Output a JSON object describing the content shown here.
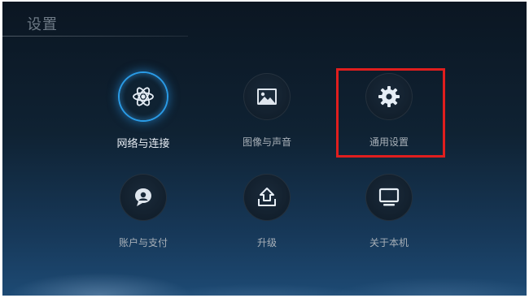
{
  "header": {
    "title": "设置"
  },
  "menu": {
    "items": [
      {
        "label": "网络与连接",
        "icon": "atom-icon",
        "selected": true
      },
      {
        "label": "图像与声音",
        "icon": "image-icon",
        "selected": false
      },
      {
        "label": "通用设置",
        "icon": "gear-icon",
        "selected": false
      },
      {
        "label": "账户与支付",
        "icon": "account-icon",
        "selected": false
      },
      {
        "label": "升级",
        "icon": "upgrade-icon",
        "selected": false
      },
      {
        "label": "关于本机",
        "icon": "monitor-icon",
        "selected": false
      }
    ]
  },
  "colors": {
    "selection_glow": "#2a9be6",
    "highlight_box": "#e01e1e",
    "background": "#0f2233"
  }
}
